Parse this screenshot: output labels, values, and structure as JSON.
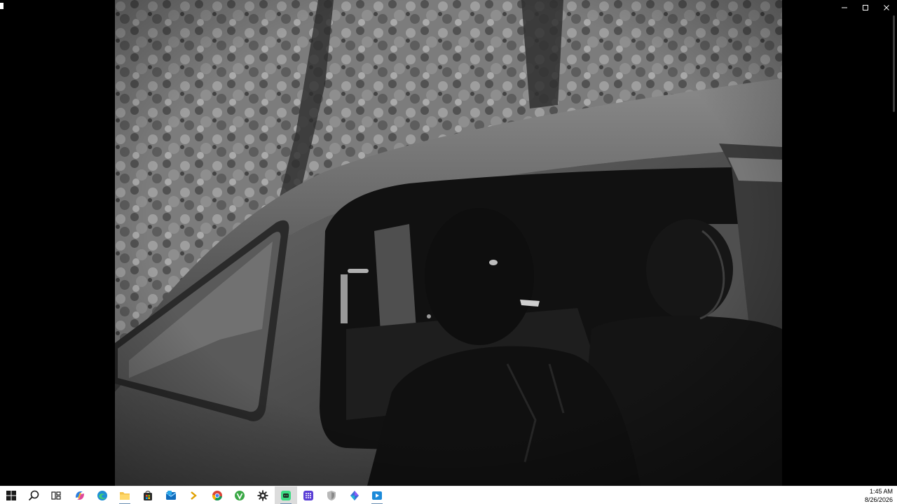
{
  "window": {
    "controls": [
      {
        "name": "minimize-button",
        "icon": "minimize-icon"
      },
      {
        "name": "maximize-button",
        "icon": "maximize-icon"
      },
      {
        "name": "close-button",
        "icon": "close-icon"
      }
    ]
  },
  "photo": {
    "subject": "two men seated in a car",
    "style": "black and white"
  },
  "taskbar": {
    "items": [
      {
        "name": "start-button",
        "icon": "windows-logo-icon"
      },
      {
        "name": "search-button",
        "icon": "search-icon"
      },
      {
        "name": "task-view-button",
        "icon": "task-view-icon"
      },
      {
        "name": "copilot-button",
        "icon": "copilot-icon"
      },
      {
        "name": "edge-button",
        "icon": "edge-icon"
      },
      {
        "name": "file-explorer-button",
        "icon": "folder-icon"
      },
      {
        "name": "store-button",
        "icon": "store-icon"
      },
      {
        "name": "mail-button",
        "icon": "mail-icon"
      },
      {
        "name": "terminal-button",
        "icon": "terminal-icon"
      },
      {
        "name": "chrome-button",
        "icon": "chrome-icon"
      },
      {
        "name": "green-app-button",
        "icon": "green-app-icon"
      },
      {
        "name": "settings-button",
        "icon": "gear-icon"
      },
      {
        "name": "chat-app-button",
        "icon": "chat-app-icon"
      },
      {
        "name": "grid-app-button",
        "icon": "grid-app-icon"
      },
      {
        "name": "shield-app-button",
        "icon": "shield-icon"
      },
      {
        "name": "diamond-app-button",
        "icon": "diamond-icon"
      },
      {
        "name": "media-player-button",
        "icon": "media-player-icon"
      }
    ],
    "clock": {
      "time": "1:45 AM",
      "date": "8/26/2026"
    },
    "colors": {
      "active_indicator": "#6b8fb3",
      "background": "#ffffff"
    }
  }
}
